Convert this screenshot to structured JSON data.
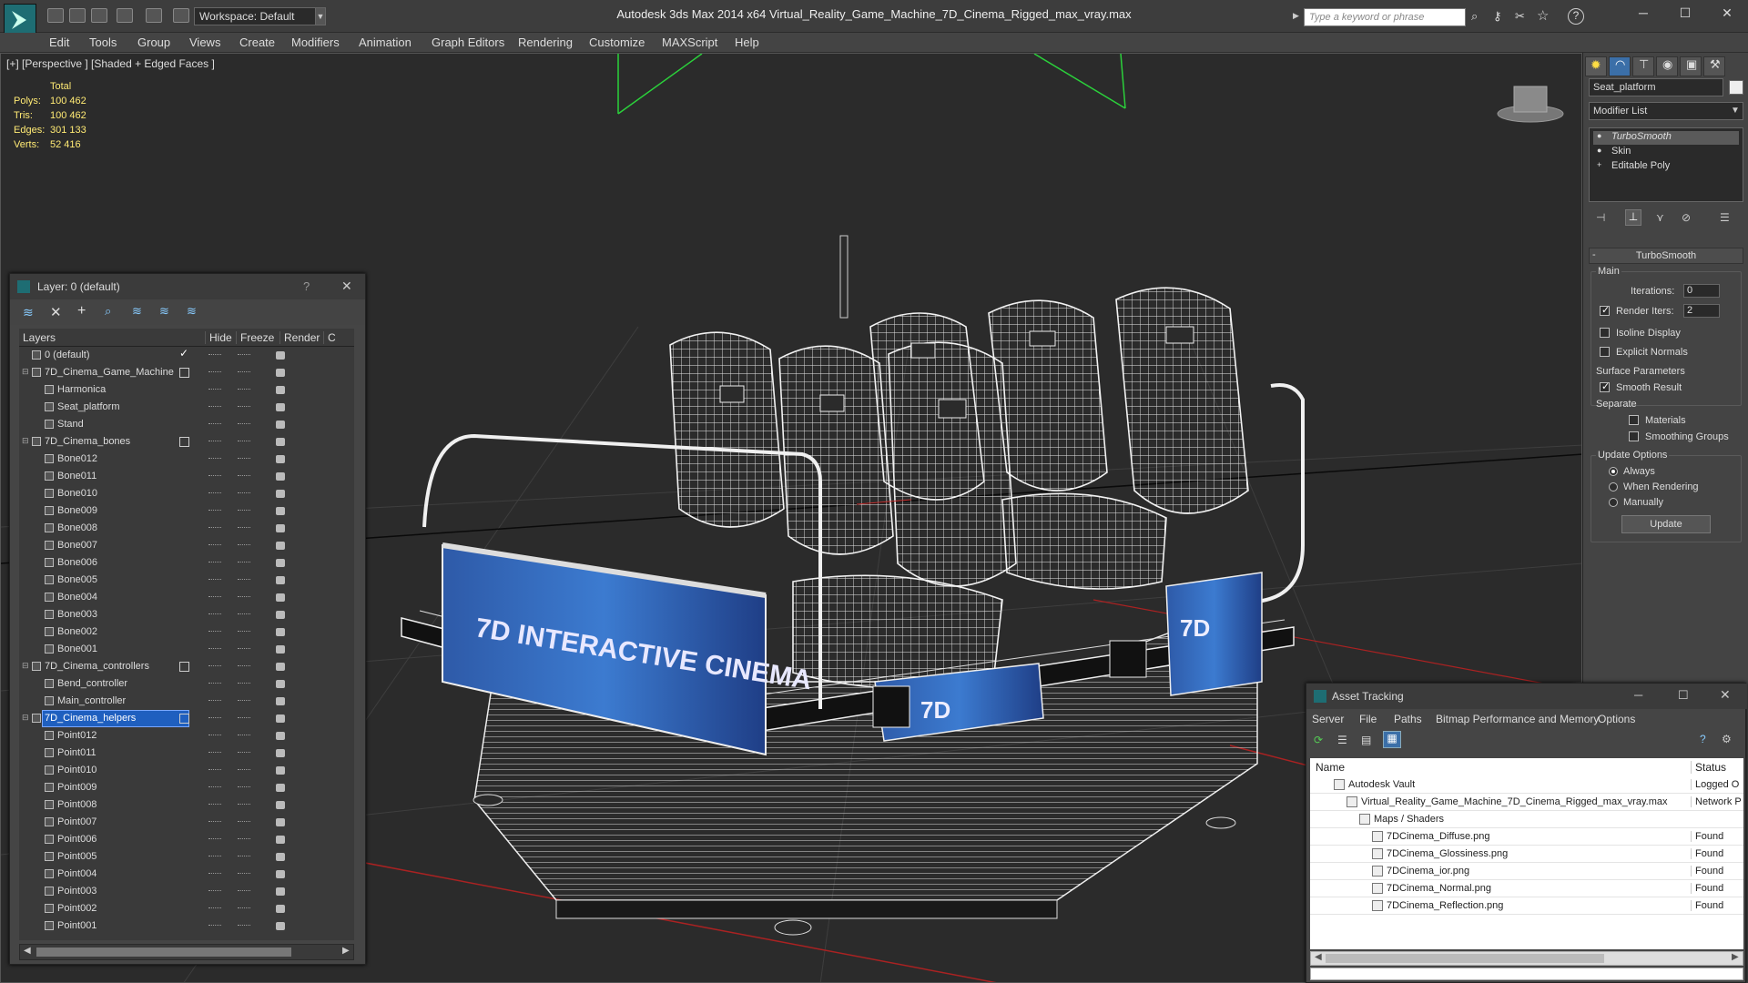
{
  "app": {
    "title": "Autodesk 3ds Max  2014 x64     Virtual_Reality_Game_Machine_7D_Cinema_Rigged_max_vray.max",
    "workspace": "Workspace: Default",
    "search_placeholder": "Type a keyword or phrase"
  },
  "menu": [
    "Edit",
    "Tools",
    "Group",
    "Views",
    "Create",
    "Modifiers",
    "Animation",
    "Graph Editors",
    "Rendering",
    "Customize",
    "MAXScript",
    "Help"
  ],
  "viewport": {
    "label": "[+] [Perspective ] [Shaded + Edged Faces ]",
    "stats": {
      "total": "Total",
      "rows": [
        {
          "label": "Polys:",
          "value": "100 462"
        },
        {
          "label": "Tris:",
          "value": "100 462"
        },
        {
          "label": "Edges:",
          "value": "301 133"
        },
        {
          "label": "Verts:",
          "value": "52 416"
        }
      ]
    },
    "billboard_text": "7D INTERACTIVE CINEMA",
    "box_text": "7D"
  },
  "layers": {
    "title": "Layer: 0 (default)",
    "help": "?",
    "columns": {
      "layers": "Layers",
      "hide": "Hide",
      "freeze": "Freeze",
      "render": "Render",
      "c": "C"
    },
    "rows": [
      {
        "name": "0 (default)",
        "level": 0,
        "check": true
      },
      {
        "name": "7D_Cinema_Game_Machine",
        "level": 0,
        "box": true
      },
      {
        "name": "Harmonica",
        "level": 1
      },
      {
        "name": "Seat_platform",
        "level": 1
      },
      {
        "name": "Stand",
        "level": 1
      },
      {
        "name": "7D_Cinema_bones",
        "level": 0,
        "box": true
      },
      {
        "name": "Bone012",
        "level": 1
      },
      {
        "name": "Bone011",
        "level": 1
      },
      {
        "name": "Bone010",
        "level": 1
      },
      {
        "name": "Bone009",
        "level": 1
      },
      {
        "name": "Bone008",
        "level": 1
      },
      {
        "name": "Bone007",
        "level": 1
      },
      {
        "name": "Bone006",
        "level": 1
      },
      {
        "name": "Bone005",
        "level": 1
      },
      {
        "name": "Bone004",
        "level": 1
      },
      {
        "name": "Bone003",
        "level": 1
      },
      {
        "name": "Bone002",
        "level": 1
      },
      {
        "name": "Bone001",
        "level": 1
      },
      {
        "name": "7D_Cinema_controllers",
        "level": 0,
        "box": true
      },
      {
        "name": "Bend_controller",
        "level": 1
      },
      {
        "name": "Main_controller",
        "level": 1
      },
      {
        "name": "7D_Cinema_helpers",
        "level": 0,
        "box": true,
        "selected": true
      },
      {
        "name": "Point012",
        "level": 1
      },
      {
        "name": "Point011",
        "level": 1
      },
      {
        "name": "Point010",
        "level": 1
      },
      {
        "name": "Point009",
        "level": 1
      },
      {
        "name": "Point008",
        "level": 1
      },
      {
        "name": "Point007",
        "level": 1
      },
      {
        "name": "Point006",
        "level": 1
      },
      {
        "name": "Point005",
        "level": 1
      },
      {
        "name": "Point004",
        "level": 1
      },
      {
        "name": "Point003",
        "level": 1
      },
      {
        "name": "Point002",
        "level": 1
      },
      {
        "name": "Point001",
        "level": 1
      }
    ]
  },
  "command_panel": {
    "object_name": "Seat_platform",
    "modifier_list": "Modifier List",
    "stack": [
      "TurboSmooth",
      "Skin",
      "Editable Poly"
    ],
    "turbosmooth": {
      "title": "TurboSmooth",
      "main": "Main",
      "iterations_label": "Iterations:",
      "iterations": "0",
      "render_iters_label": "Render Iters:",
      "render_iters": "2",
      "isoline": "Isoline Display",
      "explicit": "Explicit Normals",
      "surface": "Surface Parameters",
      "smooth_result": "Smooth Result",
      "separate": "Separate",
      "materials": "Materials",
      "smoothing_groups": "Smoothing Groups",
      "update_options": "Update Options",
      "always": "Always",
      "when_rendering": "When Rendering",
      "manually": "Manually",
      "update": "Update"
    }
  },
  "asset_tracking": {
    "title": "Asset Tracking",
    "menu": [
      "Server",
      "File",
      "Paths",
      "Bitmap Performance and Memory",
      "Options"
    ],
    "columns": {
      "name": "Name",
      "status": "Status"
    },
    "rows": [
      {
        "name": "Autodesk Vault",
        "status": "Logged O",
        "level": 1
      },
      {
        "name": "Virtual_Reality_Game_Machine_7D_Cinema_Rigged_max_vray.max",
        "status": "Network P",
        "level": 2
      },
      {
        "name": "Maps / Shaders",
        "status": "",
        "level": 3
      },
      {
        "name": "7DCinema_Diffuse.png",
        "status": "Found",
        "level": 4
      },
      {
        "name": "7DCinema_Glossiness.png",
        "status": "Found",
        "level": 4
      },
      {
        "name": "7DCinema_ior.png",
        "status": "Found",
        "level": 4
      },
      {
        "name": "7DCinema_Normal.png",
        "status": "Found",
        "level": 4
      },
      {
        "name": "7DCinema_Reflection.png",
        "status": "Found",
        "level": 4
      }
    ]
  }
}
